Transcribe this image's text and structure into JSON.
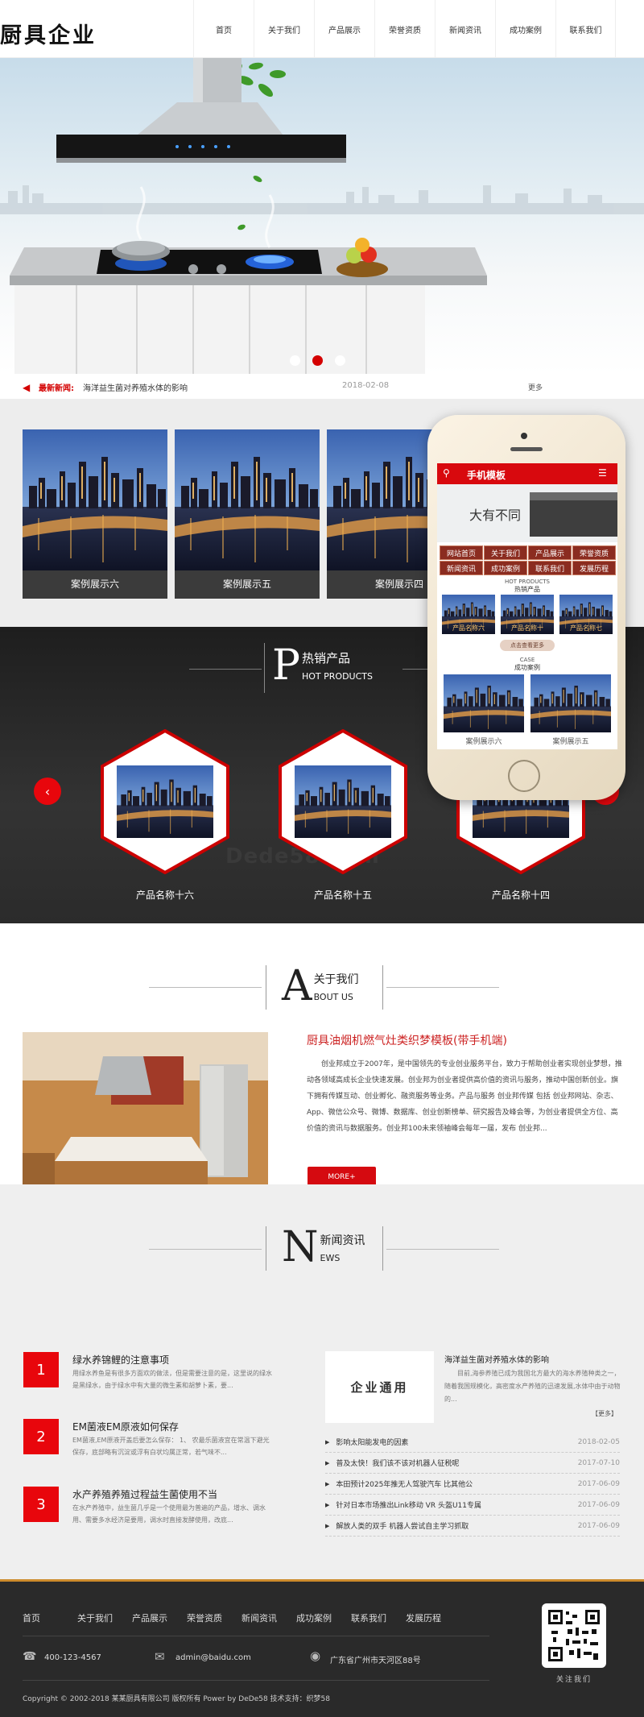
{
  "header": {
    "logo": "厨具企业",
    "nav": [
      "首页",
      "关于我们",
      "产品展示",
      "荣誉资质",
      "新闻资讯",
      "成功案例",
      "联系我们"
    ]
  },
  "ticker": {
    "label": "最新新闻:",
    "title": "海洋益生菌对养殖水体的影响",
    "date": "2018-02-08",
    "more": "更多"
  },
  "cases": [
    "案例展示六",
    "案例展示五",
    "案例展示四"
  ],
  "hot": {
    "letter": "P",
    "cn": "热销产品",
    "en": "HOT PRODUCTS",
    "products": [
      "产品名称十六",
      "产品名称十五",
      "产品名称十四"
    ],
    "watermark": "Dede58·com"
  },
  "phone": {
    "header": "手机模板",
    "menu": [
      "网站首页",
      "关于我们",
      "产品展示",
      "荣誉资质",
      "新闻资讯",
      "成功案例",
      "联系我们",
      "发展历程"
    ],
    "hot_en": "HOT PRODUCTS",
    "hot_cn": "热销产品",
    "products": [
      "产品名称六",
      "产品名称十",
      "产品名称七"
    ],
    "more": "点击查看更多",
    "case_en": "CASE",
    "case_cn": "成功案例",
    "cases": [
      "案例展示六",
      "案例展示五"
    ]
  },
  "about": {
    "letter": "A",
    "cn": "关于我们",
    "en": "BOUT US",
    "title": "厨具油烟机燃气灶类织梦模板(带手机端)",
    "body": "创业邦成立于2007年，是中国领先的专业创业服务平台，致力于帮助创业者实现创业梦想，推动各领域高成长企业快速发展。创业邦为创业者提供高价值的资讯与服务，推动中国创新创业。旗下拥有传媒互动、创业孵化、融资服务等业务。产品与服务 创业邦传媒 包括 创业邦网站、杂志、App、微信公众号、微博、数据库、创业创新榜单、研究报告及峰会等，为创业者提供全方位、高价值的资讯与数据服务。创业邦100未来领袖峰会每年一届，发布 创业邦...",
    "more": "MORE+"
  },
  "news": {
    "letter": "N",
    "cn": "新闻资讯",
    "en": "EWS",
    "items": [
      {
        "num": "1",
        "title": "绿水养锦鲤的注意事项",
        "summary": "用绿水养鱼是有很多方面欢的做法，但是需要注意的是，这里说的绿水是黑绿水，由于绿水中有大量的微生素和胡萝卜素，要..."
      },
      {
        "num": "2",
        "title": "EM菌液EM原液如何保存",
        "summary": "EM菌液,EM原液开盖后要怎么保存： 1、 农最乐菌液宜在常温下避光保存，底部略有沉淀或浮有白状均属正常，若气味不..."
      },
      {
        "num": "3",
        "title": "水产养殖养殖过程益生菌使用不当",
        "summary": "在水产养殖中，益生菌几乎是一个使用最为普遍的产品，增水、调水用、需要多水经济是要用，调水时直接发酵使用，改底..."
      }
    ],
    "feature": {
      "img_text": "企业通用",
      "title": "海洋益生菌对养殖水体的影响",
      "summary": "目前,海参养殖已成为我国北方最大的海水养殖种类之一，随着我国规模化，高密度水产养殖的迅速发展,水体中由于动物的...",
      "more": "【更多】"
    },
    "list": [
      {
        "t": "影响太阳能发电的因素",
        "d": "2018-02-05"
      },
      {
        "t": "普及太快！我们该不该对机器人征税呢",
        "d": "2017-07-10"
      },
      {
        "t": "本田预计2025年推无人驾驶汽车 比其他公",
        "d": "2017-06-09"
      },
      {
        "t": "针对日本市场推出Link移动 VR 头盔U11专属",
        "d": "2017-06-09"
      },
      {
        "t": "解放人类的双手 机器人尝试自主学习抓取",
        "d": "2017-06-09"
      }
    ]
  },
  "footer": {
    "nav": [
      "首页",
      "关于我们",
      "产品展示",
      "荣誉资质",
      "新闻资讯",
      "成功案例",
      "联系我们",
      "发展历程"
    ],
    "phone": "400-123-4567",
    "email": "admin@baidu.com",
    "address": "广东省广州市天河区88号",
    "qr_label": "关注我们",
    "copyright": "Copyright © 2002-2018 某某厨具有限公司 版权所有 Power by DeDe58 技术支持：织梦58"
  },
  "colors": {
    "accent": "#e8060c",
    "dark": "#2a2a2a",
    "footer_line": "#cc8b2c"
  }
}
